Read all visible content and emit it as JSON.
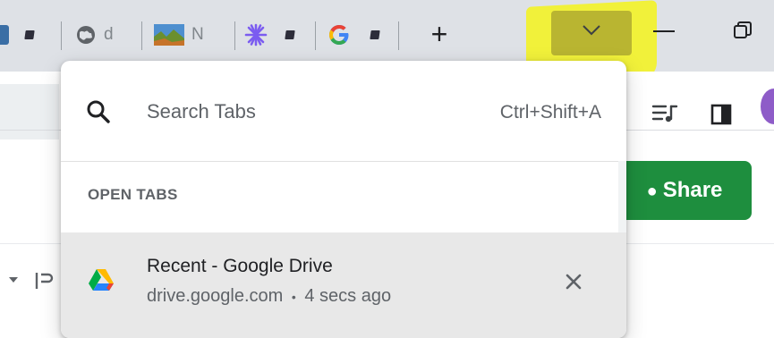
{
  "tabstrip": {
    "tabs": [
      {
        "favicon": "generic-app-icon",
        "letter": ""
      },
      {
        "favicon": "globe-icon",
        "letter": "d"
      },
      {
        "favicon": "landscape-image-icon",
        "letter": "N"
      },
      {
        "favicon": "purple-asterisk-icon",
        "letter": ""
      },
      {
        "favicon": "google-g-icon",
        "letter": ""
      }
    ],
    "new_tab_label": "+",
    "dropdown_icon": "chevron-down-icon",
    "minimize_icon": "minimize-icon",
    "restore_icon": "restore-icon"
  },
  "toolbar": {
    "reading_list_icon": "reading-list-icon",
    "side_panel_icon": "side-panel-icon"
  },
  "page": {
    "share_label": "Share",
    "share_icon": "share-icon"
  },
  "tab_search": {
    "placeholder": "Search Tabs",
    "shortcut": "Ctrl+Shift+A",
    "section_header": "OPEN TABS",
    "open_tabs": [
      {
        "title": "Recent - Google Drive",
        "domain": "drive.google.com",
        "separator": "•",
        "time": "4 secs ago",
        "icon": "google-drive-icon"
      }
    ]
  },
  "colors": {
    "tabstrip_bg": "#dee1e6",
    "highlight": "#f1f13a",
    "share_green": "#1e8e3e",
    "row_hover": "#e8e8e8"
  }
}
